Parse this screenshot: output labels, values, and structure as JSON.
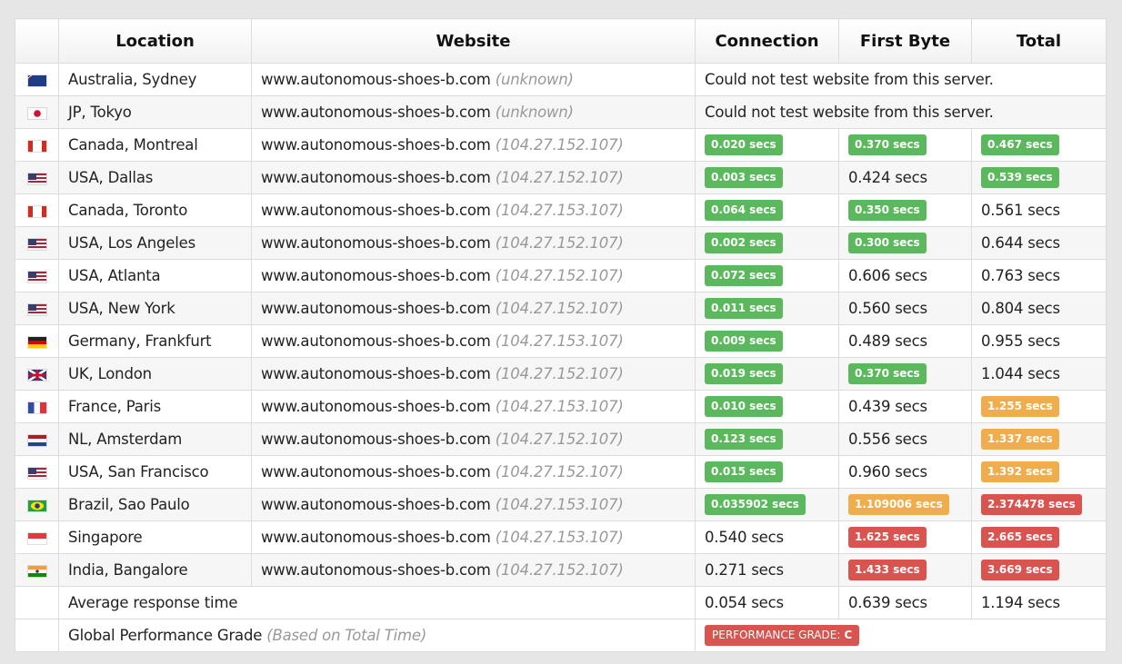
{
  "headers": {
    "flag": "",
    "location": "Location",
    "website": "Website",
    "connection": "Connection",
    "first_byte": "First Byte",
    "total": "Total"
  },
  "colors": {
    "green": "#5cb85c",
    "orange": "#f0ad4e",
    "red": "#d9534f"
  },
  "rows": [
    {
      "flag": "australia-flag-icon",
      "location": "Australia, Sydney",
      "website": "www.autonomous-shoes-b.com",
      "ip": "(unknown)",
      "error": "Could not test website from this server."
    },
    {
      "flag": "japan-flag-icon",
      "location": "JP, Tokyo",
      "website": "www.autonomous-shoes-b.com",
      "ip": "(unknown)",
      "error": "Could not test website from this server."
    },
    {
      "flag": "canada-flag-icon",
      "location": "Canada, Montreal",
      "website": "www.autonomous-shoes-b.com",
      "ip": "(104.27.152.107)",
      "connection": {
        "text": "0.020 secs",
        "status": "green"
      },
      "first_byte": {
        "text": "0.370 secs",
        "status": "green"
      },
      "total": {
        "text": "0.467 secs",
        "status": "green"
      }
    },
    {
      "flag": "usa-flag-icon",
      "location": "USA, Dallas",
      "website": "www.autonomous-shoes-b.com",
      "ip": "(104.27.152.107)",
      "connection": {
        "text": "0.003 secs",
        "status": "green"
      },
      "first_byte": {
        "text": "0.424 secs",
        "status": "plain"
      },
      "total": {
        "text": "0.539 secs",
        "status": "green"
      }
    },
    {
      "flag": "canada-flag-icon",
      "location": "Canada, Toronto",
      "website": "www.autonomous-shoes-b.com",
      "ip": "(104.27.153.107)",
      "connection": {
        "text": "0.064 secs",
        "status": "green"
      },
      "first_byte": {
        "text": "0.350 secs",
        "status": "green"
      },
      "total": {
        "text": "0.561 secs",
        "status": "plain"
      }
    },
    {
      "flag": "usa-flag-icon",
      "location": "USA, Los Angeles",
      "website": "www.autonomous-shoes-b.com",
      "ip": "(104.27.152.107)",
      "connection": {
        "text": "0.002 secs",
        "status": "green"
      },
      "first_byte": {
        "text": "0.300 secs",
        "status": "green"
      },
      "total": {
        "text": "0.644 secs",
        "status": "plain"
      }
    },
    {
      "flag": "usa-flag-icon",
      "location": "USA, Atlanta",
      "website": "www.autonomous-shoes-b.com",
      "ip": "(104.27.152.107)",
      "connection": {
        "text": "0.072 secs",
        "status": "green"
      },
      "first_byte": {
        "text": "0.606 secs",
        "status": "plain"
      },
      "total": {
        "text": "0.763 secs",
        "status": "plain"
      }
    },
    {
      "flag": "usa-flag-icon",
      "location": "USA, New York",
      "website": "www.autonomous-shoes-b.com",
      "ip": "(104.27.152.107)",
      "connection": {
        "text": "0.011 secs",
        "status": "green"
      },
      "first_byte": {
        "text": "0.560 secs",
        "status": "plain"
      },
      "total": {
        "text": "0.804 secs",
        "status": "plain"
      }
    },
    {
      "flag": "germany-flag-icon",
      "location": "Germany, Frankfurt",
      "website": "www.autonomous-shoes-b.com",
      "ip": "(104.27.153.107)",
      "connection": {
        "text": "0.009 secs",
        "status": "green"
      },
      "first_byte": {
        "text": "0.489 secs",
        "status": "plain"
      },
      "total": {
        "text": "0.955 secs",
        "status": "plain"
      }
    },
    {
      "flag": "uk-flag-icon",
      "location": "UK, London",
      "website": "www.autonomous-shoes-b.com",
      "ip": "(104.27.152.107)",
      "connection": {
        "text": "0.019 secs",
        "status": "green"
      },
      "first_byte": {
        "text": "0.370 secs",
        "status": "green"
      },
      "total": {
        "text": "1.044 secs",
        "status": "plain"
      }
    },
    {
      "flag": "france-flag-icon",
      "location": "France, Paris",
      "website": "www.autonomous-shoes-b.com",
      "ip": "(104.27.153.107)",
      "connection": {
        "text": "0.010 secs",
        "status": "green"
      },
      "first_byte": {
        "text": "0.439 secs",
        "status": "plain"
      },
      "total": {
        "text": "1.255 secs",
        "status": "orange"
      }
    },
    {
      "flag": "netherlands-flag-icon",
      "location": "NL, Amsterdam",
      "website": "www.autonomous-shoes-b.com",
      "ip": "(104.27.152.107)",
      "connection": {
        "text": "0.123 secs",
        "status": "green"
      },
      "first_byte": {
        "text": "0.556 secs",
        "status": "plain"
      },
      "total": {
        "text": "1.337 secs",
        "status": "orange"
      }
    },
    {
      "flag": "usa-flag-icon",
      "location": "USA, San Francisco",
      "website": "www.autonomous-shoes-b.com",
      "ip": "(104.27.152.107)",
      "connection": {
        "text": "0.015 secs",
        "status": "green"
      },
      "first_byte": {
        "text": "0.960 secs",
        "status": "plain"
      },
      "total": {
        "text": "1.392 secs",
        "status": "orange"
      }
    },
    {
      "flag": "brazil-flag-icon",
      "location": "Brazil, Sao Paulo",
      "website": "www.autonomous-shoes-b.com",
      "ip": "(104.27.153.107)",
      "connection": {
        "text": "0.035902 secs",
        "status": "green"
      },
      "first_byte": {
        "text": "1.109006 secs",
        "status": "orange"
      },
      "total": {
        "text": "2.374478 secs",
        "status": "red"
      }
    },
    {
      "flag": "singapore-flag-icon",
      "location": "Singapore",
      "website": "www.autonomous-shoes-b.com",
      "ip": "(104.27.153.107)",
      "connection": {
        "text": "0.540 secs",
        "status": "plain"
      },
      "first_byte": {
        "text": "1.625 secs",
        "status": "red"
      },
      "total": {
        "text": "2.665 secs",
        "status": "red"
      }
    },
    {
      "flag": "india-flag-icon",
      "location": "India, Bangalore",
      "website": "www.autonomous-shoes-b.com",
      "ip": "(104.27.152.107)",
      "connection": {
        "text": "0.271 secs",
        "status": "plain"
      },
      "first_byte": {
        "text": "1.433 secs",
        "status": "red"
      },
      "total": {
        "text": "3.669 secs",
        "status": "red"
      }
    }
  ],
  "average": {
    "label": "Average response time",
    "connection": "0.054 secs",
    "first_byte": "0.639 secs",
    "total": "1.194 secs"
  },
  "grade": {
    "label": "Global Performance Grade",
    "note": "(Based on Total Time)",
    "badge_label": "PERFORMANCE GRADE:",
    "badge_value": "C"
  }
}
